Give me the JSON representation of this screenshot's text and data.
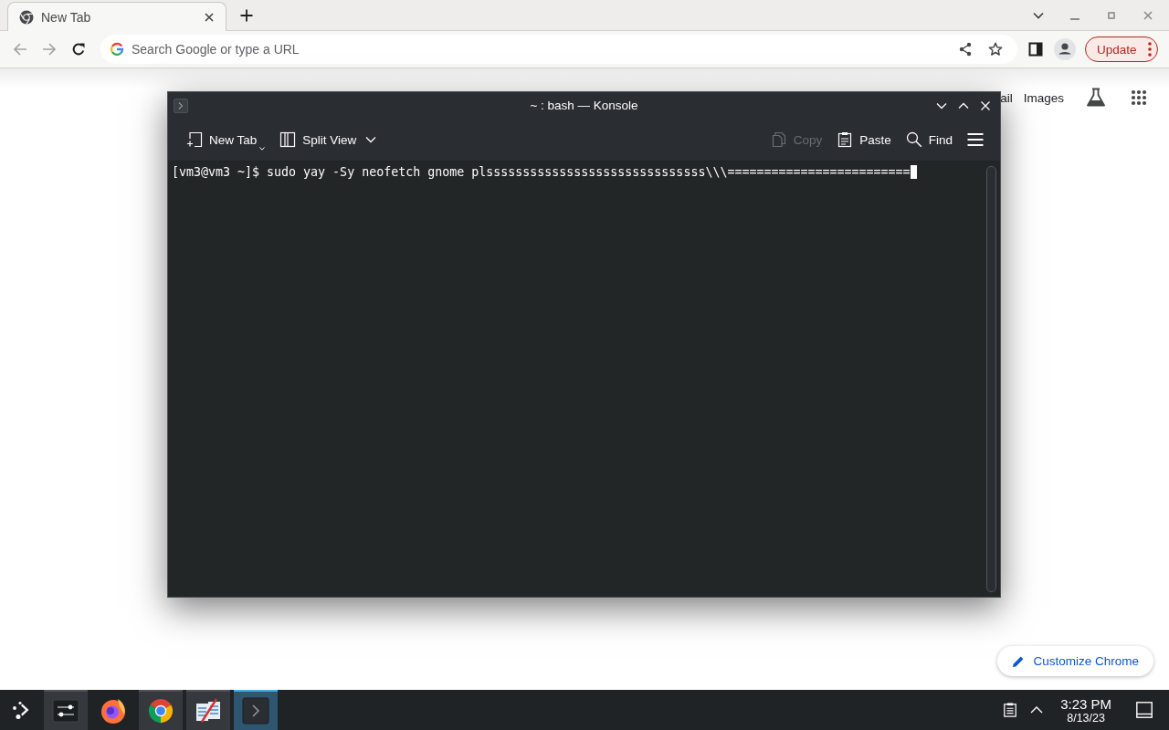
{
  "browser": {
    "tabs": [
      {
        "title": "New Tab",
        "selected": true
      }
    ],
    "toolbar": {
      "back": {
        "disabled": true
      },
      "forward": {
        "disabled": true
      },
      "omnibox": {
        "placeholder": "Search Google or type a URL"
      },
      "update_button": "Update"
    },
    "page": {
      "links": [
        "ail",
        "Images"
      ],
      "customize_button": "Customize Chrome"
    }
  },
  "konsole": {
    "title": "~ : bash — Konsole",
    "toolbar": {
      "left": [
        {
          "label": "New Tab",
          "disabled": false
        },
        {
          "label": "Split View",
          "disabled": false
        }
      ],
      "right": [
        {
          "label": "Copy",
          "disabled": true
        },
        {
          "label": "Paste",
          "disabled": false
        },
        {
          "label": "Find",
          "disabled": false
        }
      ]
    },
    "lines": [
      "[vm3@vm3 ~]$ sudo yay -Sy neofetch gnome plssssssssssssssssssssssssssssss\\\\\\========================="
    ]
  },
  "taskbar": {
    "tasks": [
      {
        "running": true,
        "active": false
      },
      {
        "running": false,
        "active": false
      },
      {
        "running": true,
        "active": false
      },
      {
        "running": true,
        "active": false
      },
      {
        "running": true,
        "active": true
      }
    ],
    "clock": {
      "time": "3:23 PM",
      "date": "8/13/23"
    }
  }
}
